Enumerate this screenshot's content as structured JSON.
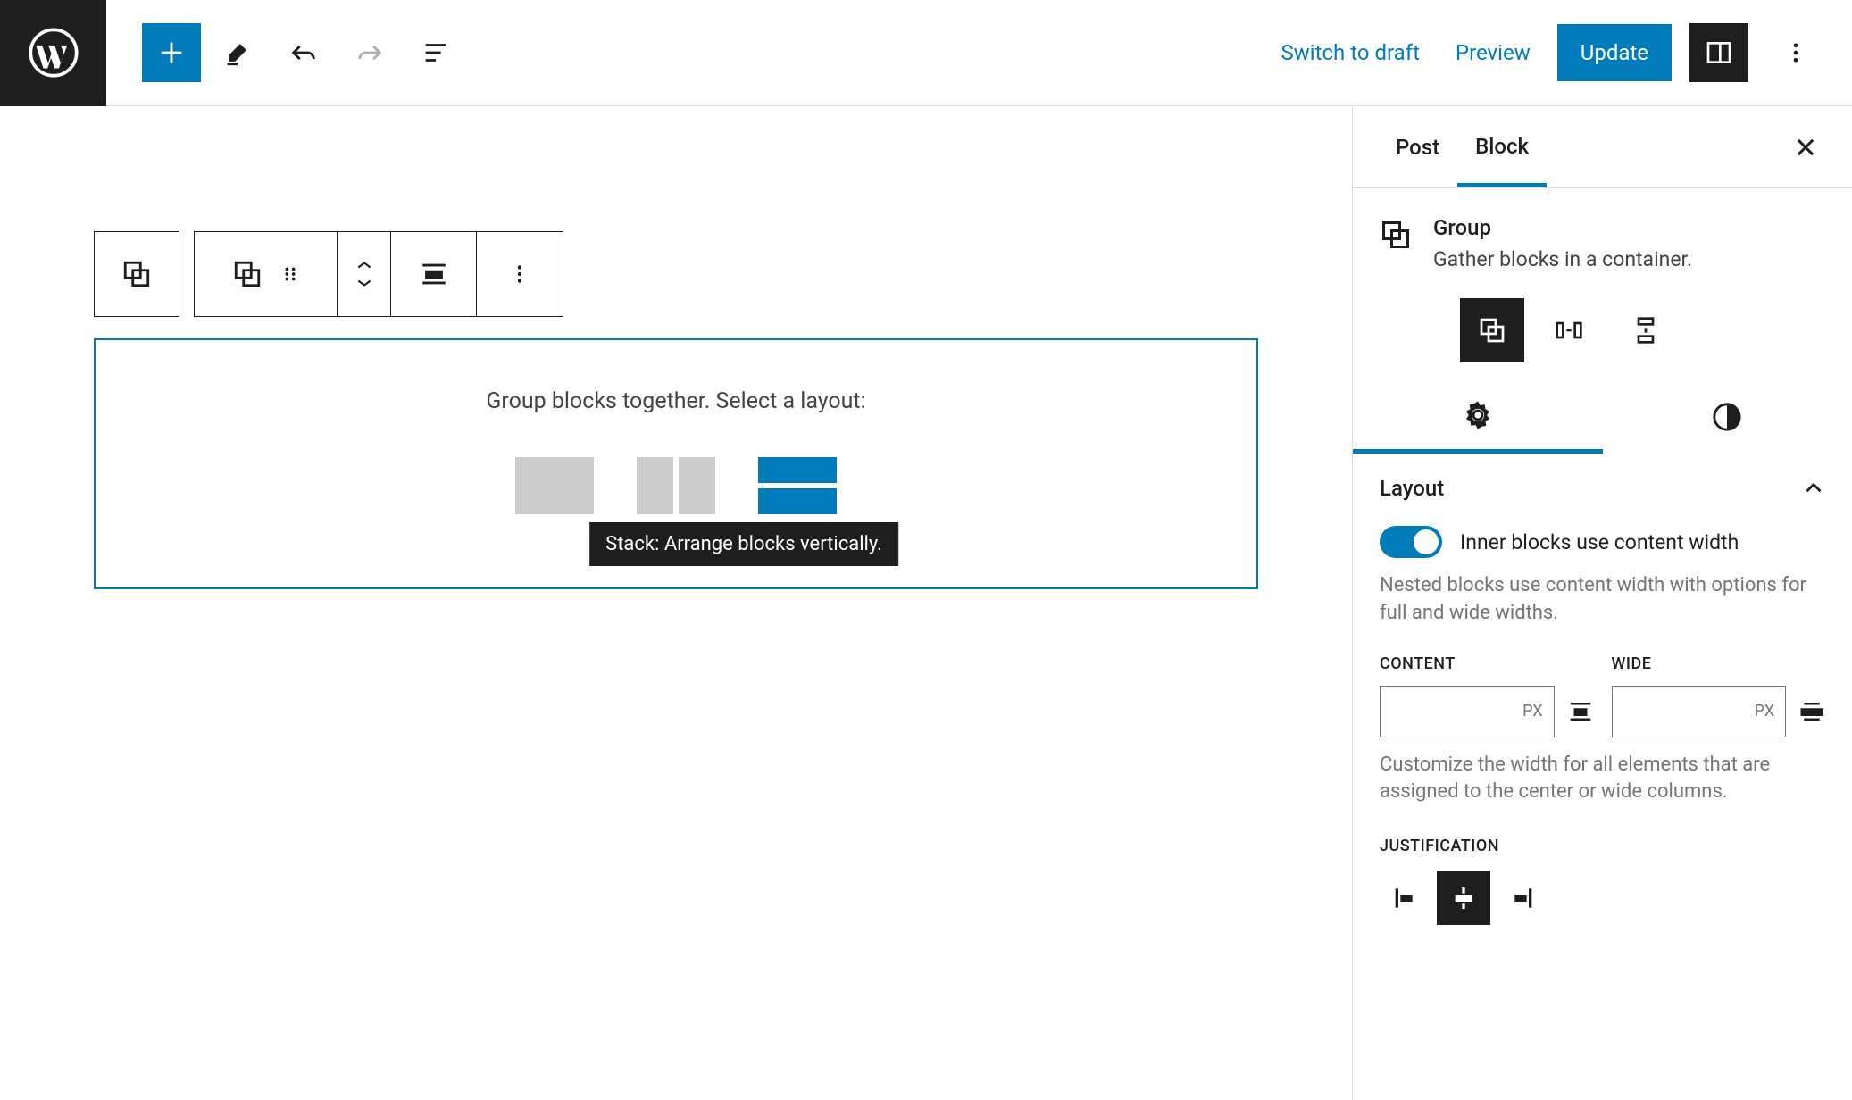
{
  "topbar": {
    "switch_draft": "Switch to draft",
    "preview": "Preview",
    "update": "Update"
  },
  "canvas": {
    "group_prompt": "Group blocks together. Select a layout:",
    "tooltip": "Stack: Arrange blocks vertically."
  },
  "sidebar": {
    "tabs": {
      "post": "Post",
      "block": "Block"
    },
    "block": {
      "title": "Group",
      "desc": "Gather blocks in a container."
    },
    "layout": {
      "title": "Layout",
      "toggle_label": "Inner blocks use content width",
      "toggle_help": "Nested blocks use content width with options for full and wide widths.",
      "content_label": "CONTENT",
      "wide_label": "WIDE",
      "unit": "PX",
      "width_help": "Customize the width for all elements that are assigned to the center or wide columns.",
      "justification_label": "JUSTIFICATION"
    }
  }
}
